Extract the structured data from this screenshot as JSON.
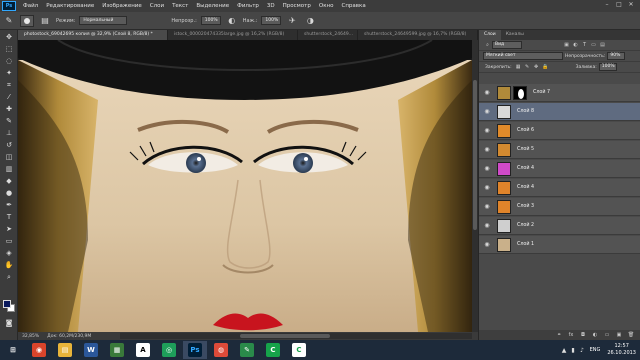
{
  "app": {
    "logo": "Ps",
    "menu": [
      "Файл",
      "Редактирование",
      "Изображение",
      "Слои",
      "Текст",
      "Выделение",
      "Фильтр",
      "3D",
      "Просмотр",
      "Окно",
      "Справка"
    ],
    "window_controls": [
      "–",
      "□",
      "✕"
    ]
  },
  "options": {
    "mode_label": "Режим:",
    "mode_value": "Нормальный",
    "opacity_label": "Непрозр.:",
    "opacity_value": "100%",
    "flow_label": "Наж.:",
    "flow_value": "100%"
  },
  "tabs": [
    {
      "label": "photostock_69042695 копия @ 32,9% (Слой 8, RGB/8) *",
      "active": true
    },
    {
      "label": "istock_000020474335large.jpg @ 16,2% (RGB/8)",
      "active": false
    },
    {
      "label": "shutterstock_24649...",
      "active": false
    },
    {
      "label": "shutterstock_24649599.jpg @ 16,7% (RGB/8)",
      "active": false
    }
  ],
  "status": {
    "zoom": "32,85%",
    "doc": "Док: 60,2M/230,9M"
  },
  "layers_panel": {
    "tabs": [
      "Слои",
      "Каналы"
    ],
    "filter_label": "Вид",
    "blend_mode": "Мягкий свет",
    "opacity_label": "Непрозрачность:",
    "opacity_value": "90%",
    "lock_label": "Закрепить:",
    "fill_label": "Заливка:",
    "fill_value": "100%",
    "layers": [
      {
        "name": "Слой 7",
        "thumb_color": "#b08a3a",
        "has_mask": true,
        "selected": false
      },
      {
        "name": "Слой 8",
        "thumb_color": "#d9d9d9",
        "has_mask": false,
        "selected": true
      },
      {
        "name": "Слой 6",
        "thumb_color": "#e08a2a",
        "has_mask": false,
        "selected": false
      },
      {
        "name": "Слой 5",
        "thumb_color": "#d38a30",
        "has_mask": false,
        "selected": false
      },
      {
        "name": "Слой 4",
        "thumb_color": "#d04ac8",
        "has_mask": false,
        "selected": false
      },
      {
        "name": "Слой 4",
        "thumb_color": "#e0842a",
        "has_mask": false,
        "selected": false
      },
      {
        "name": "Слой 3",
        "thumb_color": "#e0842a",
        "has_mask": false,
        "selected": false
      },
      {
        "name": "Слой 2",
        "thumb_color": "#cfcfcf",
        "has_mask": false,
        "selected": false
      },
      {
        "name": "Слой 1",
        "thumb_color": "#c9b08a",
        "has_mask": false,
        "selected": false
      }
    ]
  },
  "taskbar": {
    "apps": [
      {
        "label": "⊞",
        "bg": "#1d2a3a",
        "fg": "#ffffff"
      },
      {
        "label": "◉",
        "bg": "#d9442b",
        "fg": "#ffffff"
      },
      {
        "label": "▤",
        "bg": "#e8b43a",
        "fg": "#ffffff"
      },
      {
        "label": "W",
        "bg": "#2b579a",
        "fg": "#ffffff"
      },
      {
        "label": "▦",
        "bg": "#3a7a3a",
        "fg": "#ffffff"
      },
      {
        "label": "A",
        "bg": "#ffffff",
        "fg": "#000000"
      },
      {
        "label": "◎",
        "bg": "#1e9e5a",
        "fg": "#ffffff"
      },
      {
        "label": "Ps",
        "bg": "#001e36",
        "fg": "#31a8ff"
      },
      {
        "label": "◍",
        "bg": "#dd4b39",
        "fg": "#ffffff"
      },
      {
        "label": "✎",
        "bg": "#2a8a4a",
        "fg": "#ffffff"
      },
      {
        "label": "C",
        "bg": "#16a34a",
        "fg": "#ffffff"
      },
      {
        "label": "C",
        "bg": "#ffffff",
        "fg": "#16a34a"
      }
    ],
    "lang": "ENG",
    "time": "12:57",
    "date": "26.10.2013"
  }
}
